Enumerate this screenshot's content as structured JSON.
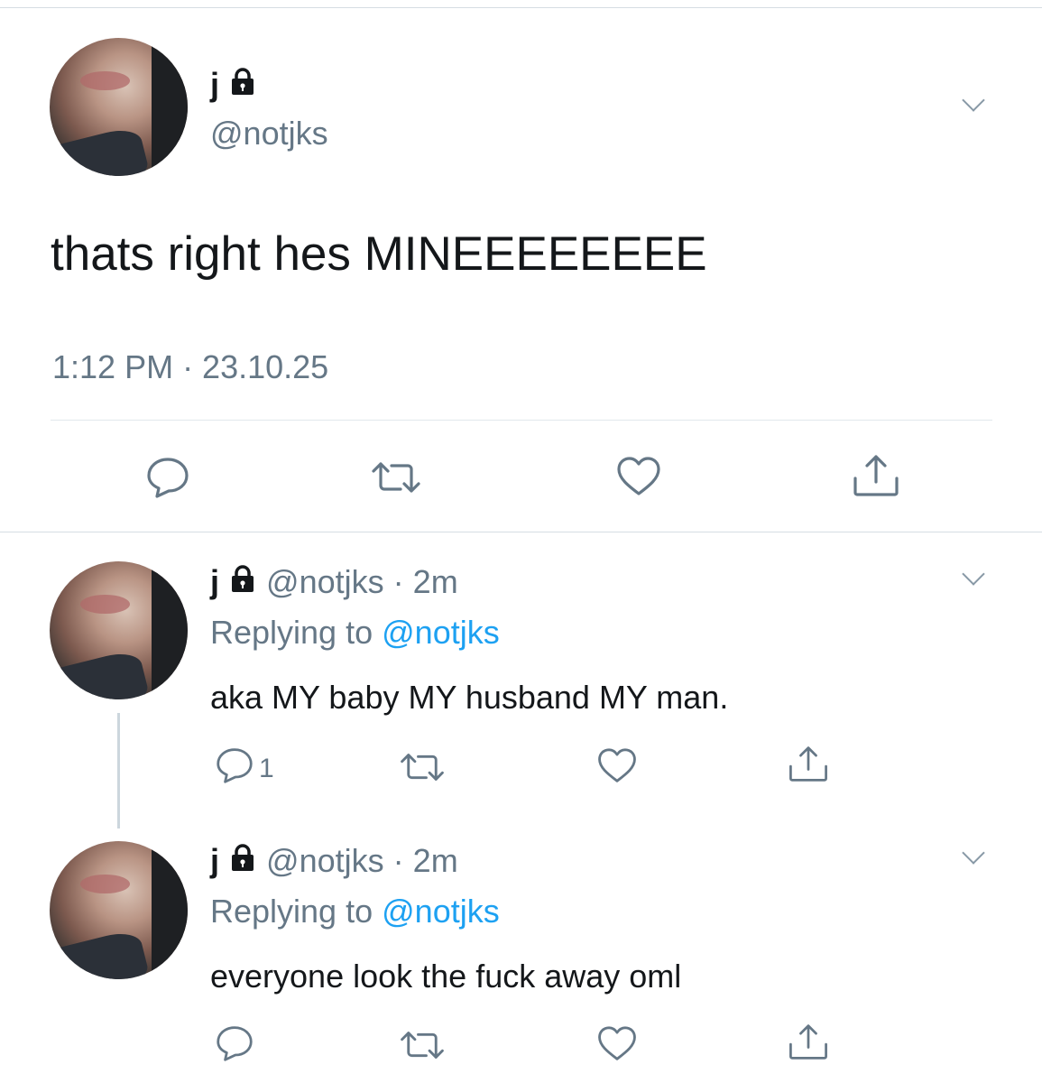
{
  "main_tweet": {
    "display_name": "j",
    "handle": "@notjks",
    "text": "thats right hes MINEEEEEEEE",
    "timestamp": "1:12 PM · 23.10.25",
    "locked": true
  },
  "replies": [
    {
      "display_name": "j",
      "handle": "@notjks",
      "separator": "·",
      "time": "2m",
      "replying_prefix": "Replying to",
      "replying_handle": "@notjks",
      "text": "aka MY baby MY husband MY man.",
      "reply_count": "1"
    },
    {
      "display_name": "j",
      "handle": "@notjks",
      "separator": "·",
      "time": "2m",
      "replying_prefix": "Replying to",
      "replying_handle": "@notjks",
      "text": "everyone look the fuck away oml",
      "reply_count": ""
    }
  ],
  "icons": {
    "reply": "reply-icon",
    "retweet": "retweet-icon",
    "like": "like-icon",
    "share": "share-icon",
    "lock": "lock-icon",
    "more": "chevron-down-icon"
  },
  "colors": {
    "text": "#14171a",
    "secondary": "#657786",
    "link": "#1da1f2",
    "icon": "#657786",
    "divider": "#e1e8ed"
  }
}
